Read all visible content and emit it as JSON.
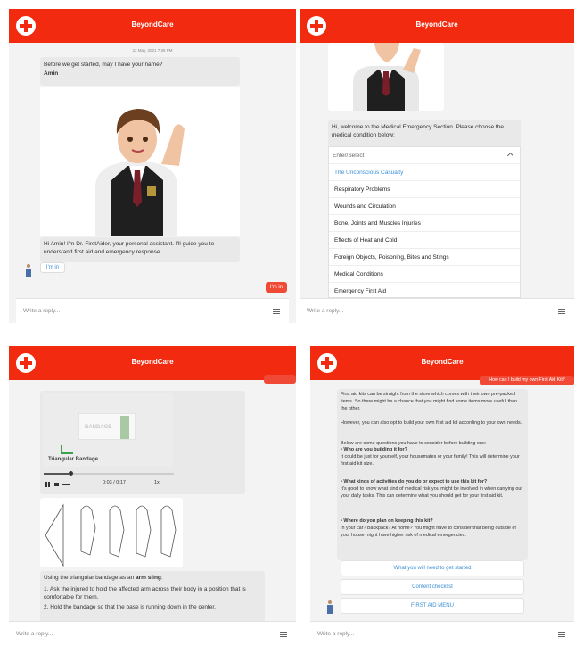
{
  "app_title": "BeyondCare",
  "footer": {
    "placeholder": "Write a reply..."
  },
  "panel1": {
    "timestamp": "22 May, 2021 7:36 PM",
    "question": "Before we get started, may I have your name?",
    "name_answer": "Amin",
    "intro": "Hi Amin! I'm Dr. FirstAider, your personal assistant. I'll guide you to understand first aid and emergency response.",
    "chip_label": "I'm in",
    "reply_label": "I'm in"
  },
  "panel2": {
    "welcome": "Hi, welcome to the Medical Emergency Section. Please choose the medical condition below:",
    "select_placeholder": "Enter/Select",
    "options": [
      "The Unconscious Casualty",
      "Respiratory Problems",
      "Wounds and Circulation",
      "Bone, Joints and Muscles Injuries",
      "Effects of Heat and Cold",
      "Foreign Objects, Poisoning, Bites and Stings",
      "Medical Conditions",
      "Emergency First Aid"
    ]
  },
  "panel3": {
    "image_label": "Triangular Bandage",
    "package_text": "BANDAGE",
    "audio_time": "0:03 / 0:17",
    "speed": "1x",
    "lead": "Using the triangular bandage as an",
    "lead_bold": "arm sling",
    "lead_end": ":",
    "step1": "1. Ask the injured to hold the affected arm across their body in a position that is comfortable for them.",
    "step2": "2. Hold the bandage so that the base is running down in the center."
  },
  "panel4": {
    "user_question": "How can I build my own First Aid Kit?",
    "p1": "First aid kits can be straight from the store which comes with their own pre-packed items. So there might be a chance that you might find some items more useful than the other.",
    "p2": "However, you can also opt to build your own first aid kit according to your own needs.",
    "p3": "Below are some questions you have to consider before building one:",
    "q1": "• Who are you building it for?",
    "a1": "It could be just for yourself, your housemates or your family! This will determine your first aid kit size.",
    "q2": "• What kinds of activities do you do or expect to use this kit for?",
    "a2": "It's good to know what kind of medical risk you might be involved in when carrying out your daily tasks. This can determine what you should get for your first aid kit.",
    "q3": "• Where do you plan on keeping this kit?",
    "a3": "In your car? Backpack? At home? You might have to consider that being outside of your house might have higher risk of medical emergencies.",
    "buttons": [
      "What you will need to get started",
      "Content checklist",
      "FIRST AID MENU"
    ]
  }
}
